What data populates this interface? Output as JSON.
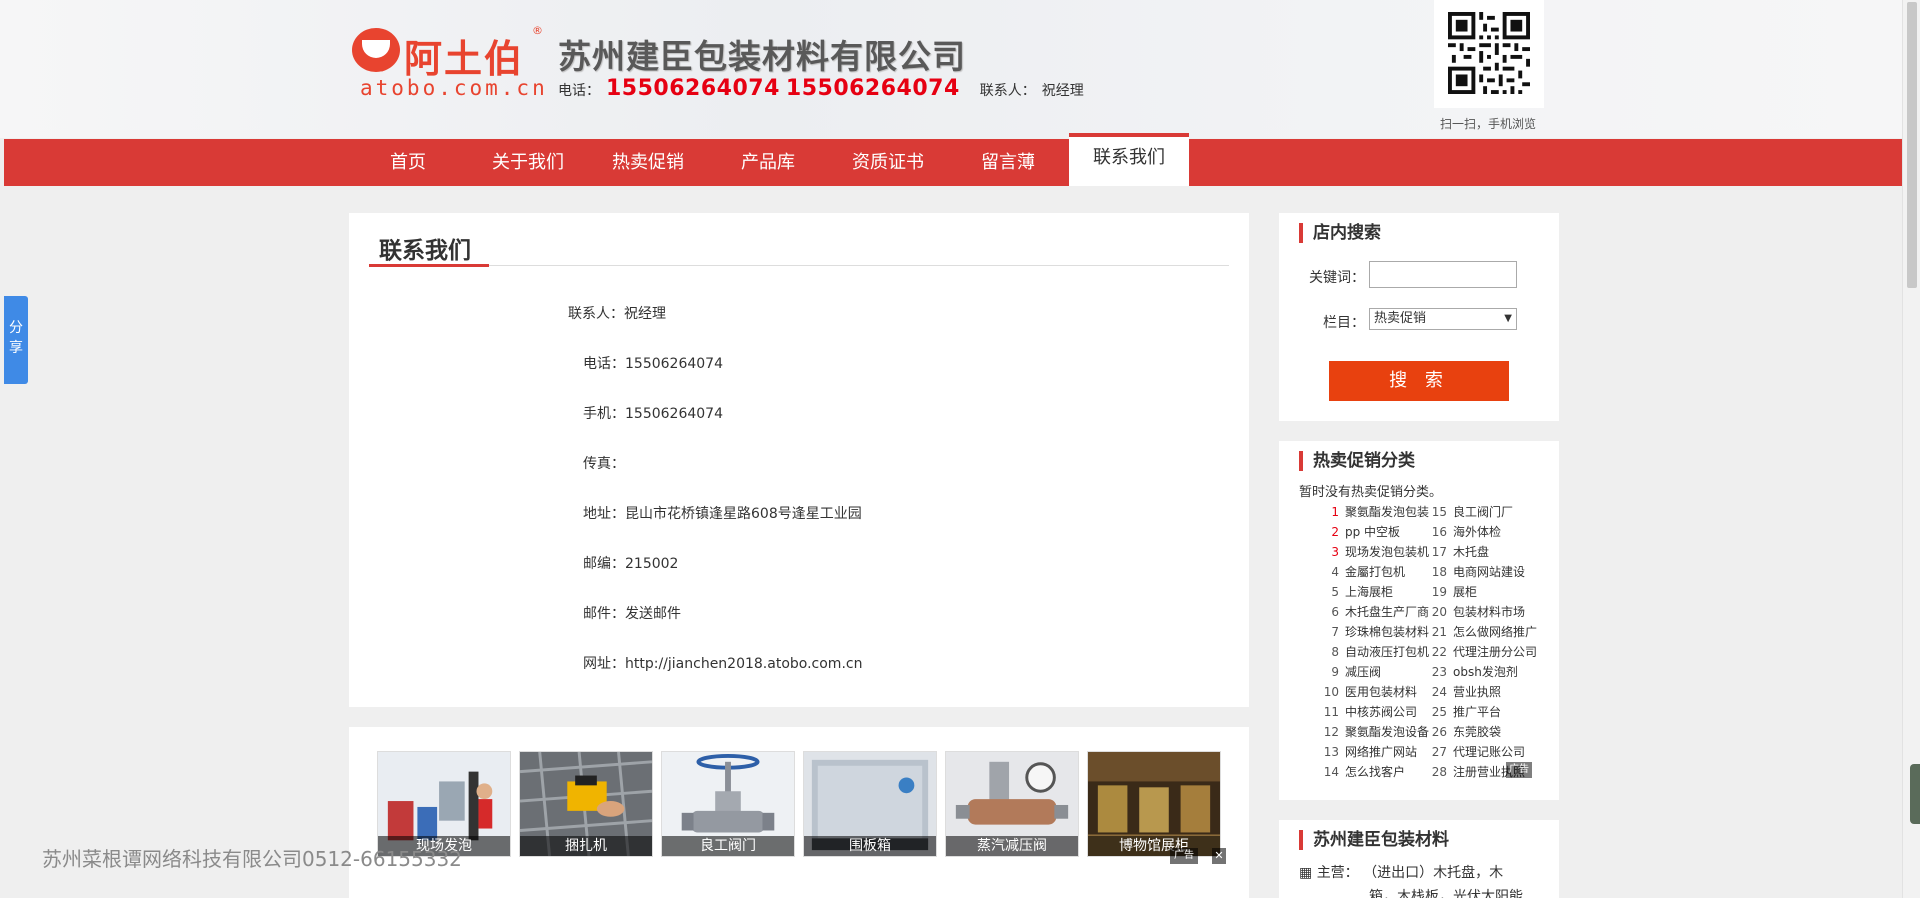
{
  "header": {
    "logo_cn": "阿土伯",
    "logo_reg": "®",
    "logo_url": "atobo.com.cn",
    "company_name": "苏州建臣包装材料有限公司",
    "phone_label": "电话：",
    "phone1": "15506264074",
    "phone2": "15506264074",
    "contact_label": "联系人：",
    "contact_name": "祝经理",
    "qr_caption": "扫一扫，手机浏览"
  },
  "nav": {
    "items": [
      "首页",
      "关于我们",
      "热卖促销",
      "产品库",
      "资质证书",
      "留言薄",
      "联系我们"
    ],
    "active_index": 6
  },
  "main": {
    "title": "联系我们",
    "rows": [
      {
        "label": "联系人：",
        "value": "祝经理"
      },
      {
        "label": "电话：",
        "value": "15506264074"
      },
      {
        "label": "手机：",
        "value": "15506264074"
      },
      {
        "label": "传真：",
        "value": ""
      },
      {
        "label": "地址：",
        "value": "昆山市花桥镇逢星路608号逢星工业园"
      },
      {
        "label": "邮编：",
        "value": "215002"
      },
      {
        "label": "邮件：",
        "value": "发送邮件"
      },
      {
        "label": "网址：",
        "value": "http://jianchen2018.atobo.com.cn"
      }
    ]
  },
  "products": {
    "items": [
      "现场发泡",
      "捆扎机",
      "良工阀门",
      "围板箱",
      "蒸汽减压阀",
      "博物馆展柜"
    ],
    "ad_label": "广告",
    "ad_close": "✕"
  },
  "footer_overlay": "苏州菜根谭网络科技有限公司0512-66155332",
  "sidebar": {
    "search": {
      "title": "店内搜索",
      "keyword_label": "关键词：",
      "keyword_value": "",
      "category_label": "栏目：",
      "category_value": "热卖促销",
      "button_label": "搜 索"
    },
    "categories": {
      "title": "热卖促销分类",
      "empty_text": "暂时没有热卖促销分类。",
      "left": [
        {
          "n": "1",
          "t": "聚氨酯发泡包装"
        },
        {
          "n": "2",
          "t": "pp 中空板"
        },
        {
          "n": "3",
          "t": "现场发泡包装机"
        },
        {
          "n": "4",
          "t": "金屬打包机"
        },
        {
          "n": "5",
          "t": "上海展柜"
        },
        {
          "n": "6",
          "t": "木托盘生产厂商"
        },
        {
          "n": "7",
          "t": "珍珠棉包装材料"
        },
        {
          "n": "8",
          "t": "自动液压打包机"
        },
        {
          "n": "9",
          "t": "减压阀"
        },
        {
          "n": "10",
          "t": "医用包装材料"
        },
        {
          "n": "11",
          "t": "中核苏阀公司"
        },
        {
          "n": "12",
          "t": "聚氨酯发泡设备"
        },
        {
          "n": "13",
          "t": "网络推广网站"
        },
        {
          "n": "14",
          "t": "怎么找客户"
        }
      ],
      "right": [
        {
          "n": "15",
          "t": "良工阀门厂"
        },
        {
          "n": "16",
          "t": "海外体检"
        },
        {
          "n": "17",
          "t": "木托盘"
        },
        {
          "n": "18",
          "t": "电商网站建设"
        },
        {
          "n": "19",
          "t": "展柜"
        },
        {
          "n": "20",
          "t": "包装材料市场"
        },
        {
          "n": "21",
          "t": "怎么做网络推广"
        },
        {
          "n": "22",
          "t": "代理注册分公司"
        },
        {
          "n": "23",
          "t": "obsh发泡剂"
        },
        {
          "n": "24",
          "t": "营业执照"
        },
        {
          "n": "25",
          "t": "推广平台"
        },
        {
          "n": "26",
          "t": "东莞胶袋"
        },
        {
          "n": "27",
          "t": "代理记账公司"
        },
        {
          "n": "28",
          "t": "注册营业执照"
        }
      ],
      "ad_label": "广告"
    },
    "company": {
      "title": "苏州建臣包装材料",
      "main_label": "主营：",
      "main_line1": "（进出口）木托盘，木",
      "main_line2": "箱，木栈板，光伏太阳能"
    }
  },
  "share": {
    "label": "分享"
  },
  "colors": {
    "brand_red": "#d93a36",
    "phone_red": "#e60012",
    "button_orange": "#e8410f",
    "share_blue": "#3f8ae6"
  }
}
